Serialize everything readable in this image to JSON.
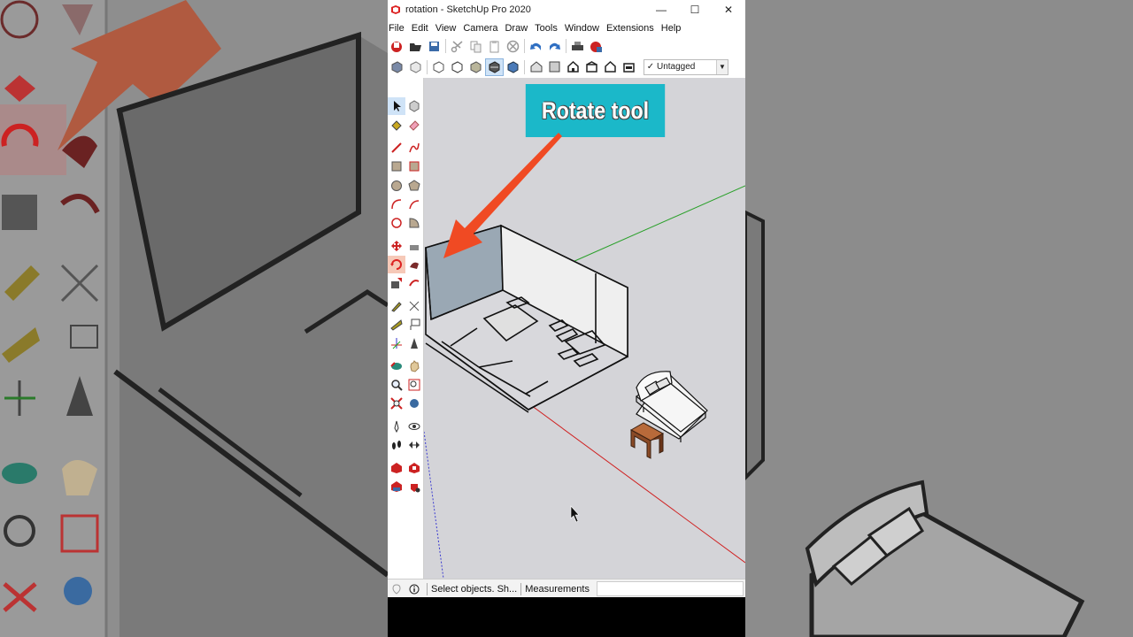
{
  "window": {
    "title": "rotation - SketchUp Pro 2020"
  },
  "menu": [
    "File",
    "Edit",
    "View",
    "Camera",
    "Draw",
    "Tools",
    "Window",
    "Extensions",
    "Help"
  ],
  "tag_selector": {
    "value": "Untagged"
  },
  "callout": {
    "text": "Rotate tool"
  },
  "status": {
    "hint": "Select objects. Sh...",
    "measurements_label": "Measurements"
  },
  "colors": {
    "callout": "#1bb8c9",
    "arrow": "#f04a23",
    "axis_red": "#d02020",
    "axis_green": "#2aa02a",
    "axis_blue": "#3b3bd0",
    "viewport": "#d4d4d8"
  }
}
